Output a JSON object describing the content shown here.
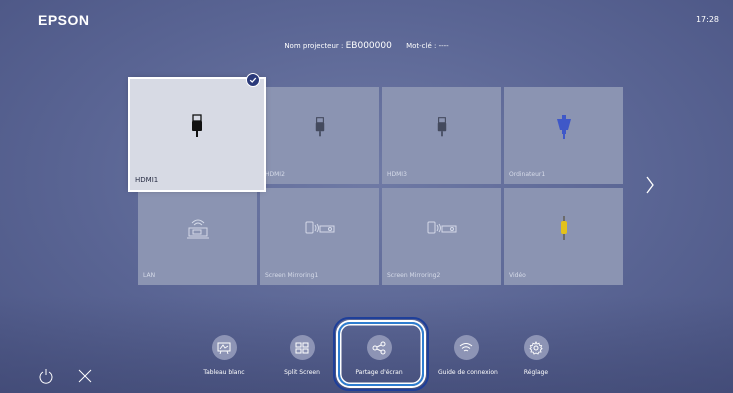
{
  "brand": "EPSON",
  "clock": "17:28",
  "projector": {
    "name_label": "Nom projecteur :",
    "name_value": "EB000000",
    "keyword_label": "Mot-clé :",
    "keyword_value": "----"
  },
  "sources": [
    {
      "label": "HDMI1",
      "icon": "hdmi-icon",
      "selected": true
    },
    {
      "label": "HDMI2",
      "icon": "hdmi-icon"
    },
    {
      "label": "HDMI3",
      "icon": "hdmi-icon"
    },
    {
      "label": "Ordinateur1",
      "icon": "vga-icon"
    },
    {
      "label": "LAN",
      "icon": "lan-icon"
    },
    {
      "label": "Screen Mirroring1",
      "icon": "screen-mirroring-icon"
    },
    {
      "label": "Screen Mirroring2",
      "icon": "screen-mirroring-icon"
    },
    {
      "label": "Vidéo",
      "icon": "rca-video-icon"
    }
  ],
  "dock": [
    {
      "label": "Tableau blanc",
      "icon": "whiteboard-icon"
    },
    {
      "label": "Split Screen",
      "icon": "split-screen-icon"
    },
    {
      "label": "Partage d'écran",
      "icon": "share-icon",
      "focused": true
    },
    {
      "label": "Guide de connexion",
      "icon": "wireless-icon"
    },
    {
      "label": "Réglage",
      "icon": "gear-icon"
    }
  ],
  "colors": {
    "accent_focus": "#2f7ed0",
    "selected_check": "#2b3a7a",
    "vga": "#3f58c8",
    "rca": "#e3c21a"
  }
}
